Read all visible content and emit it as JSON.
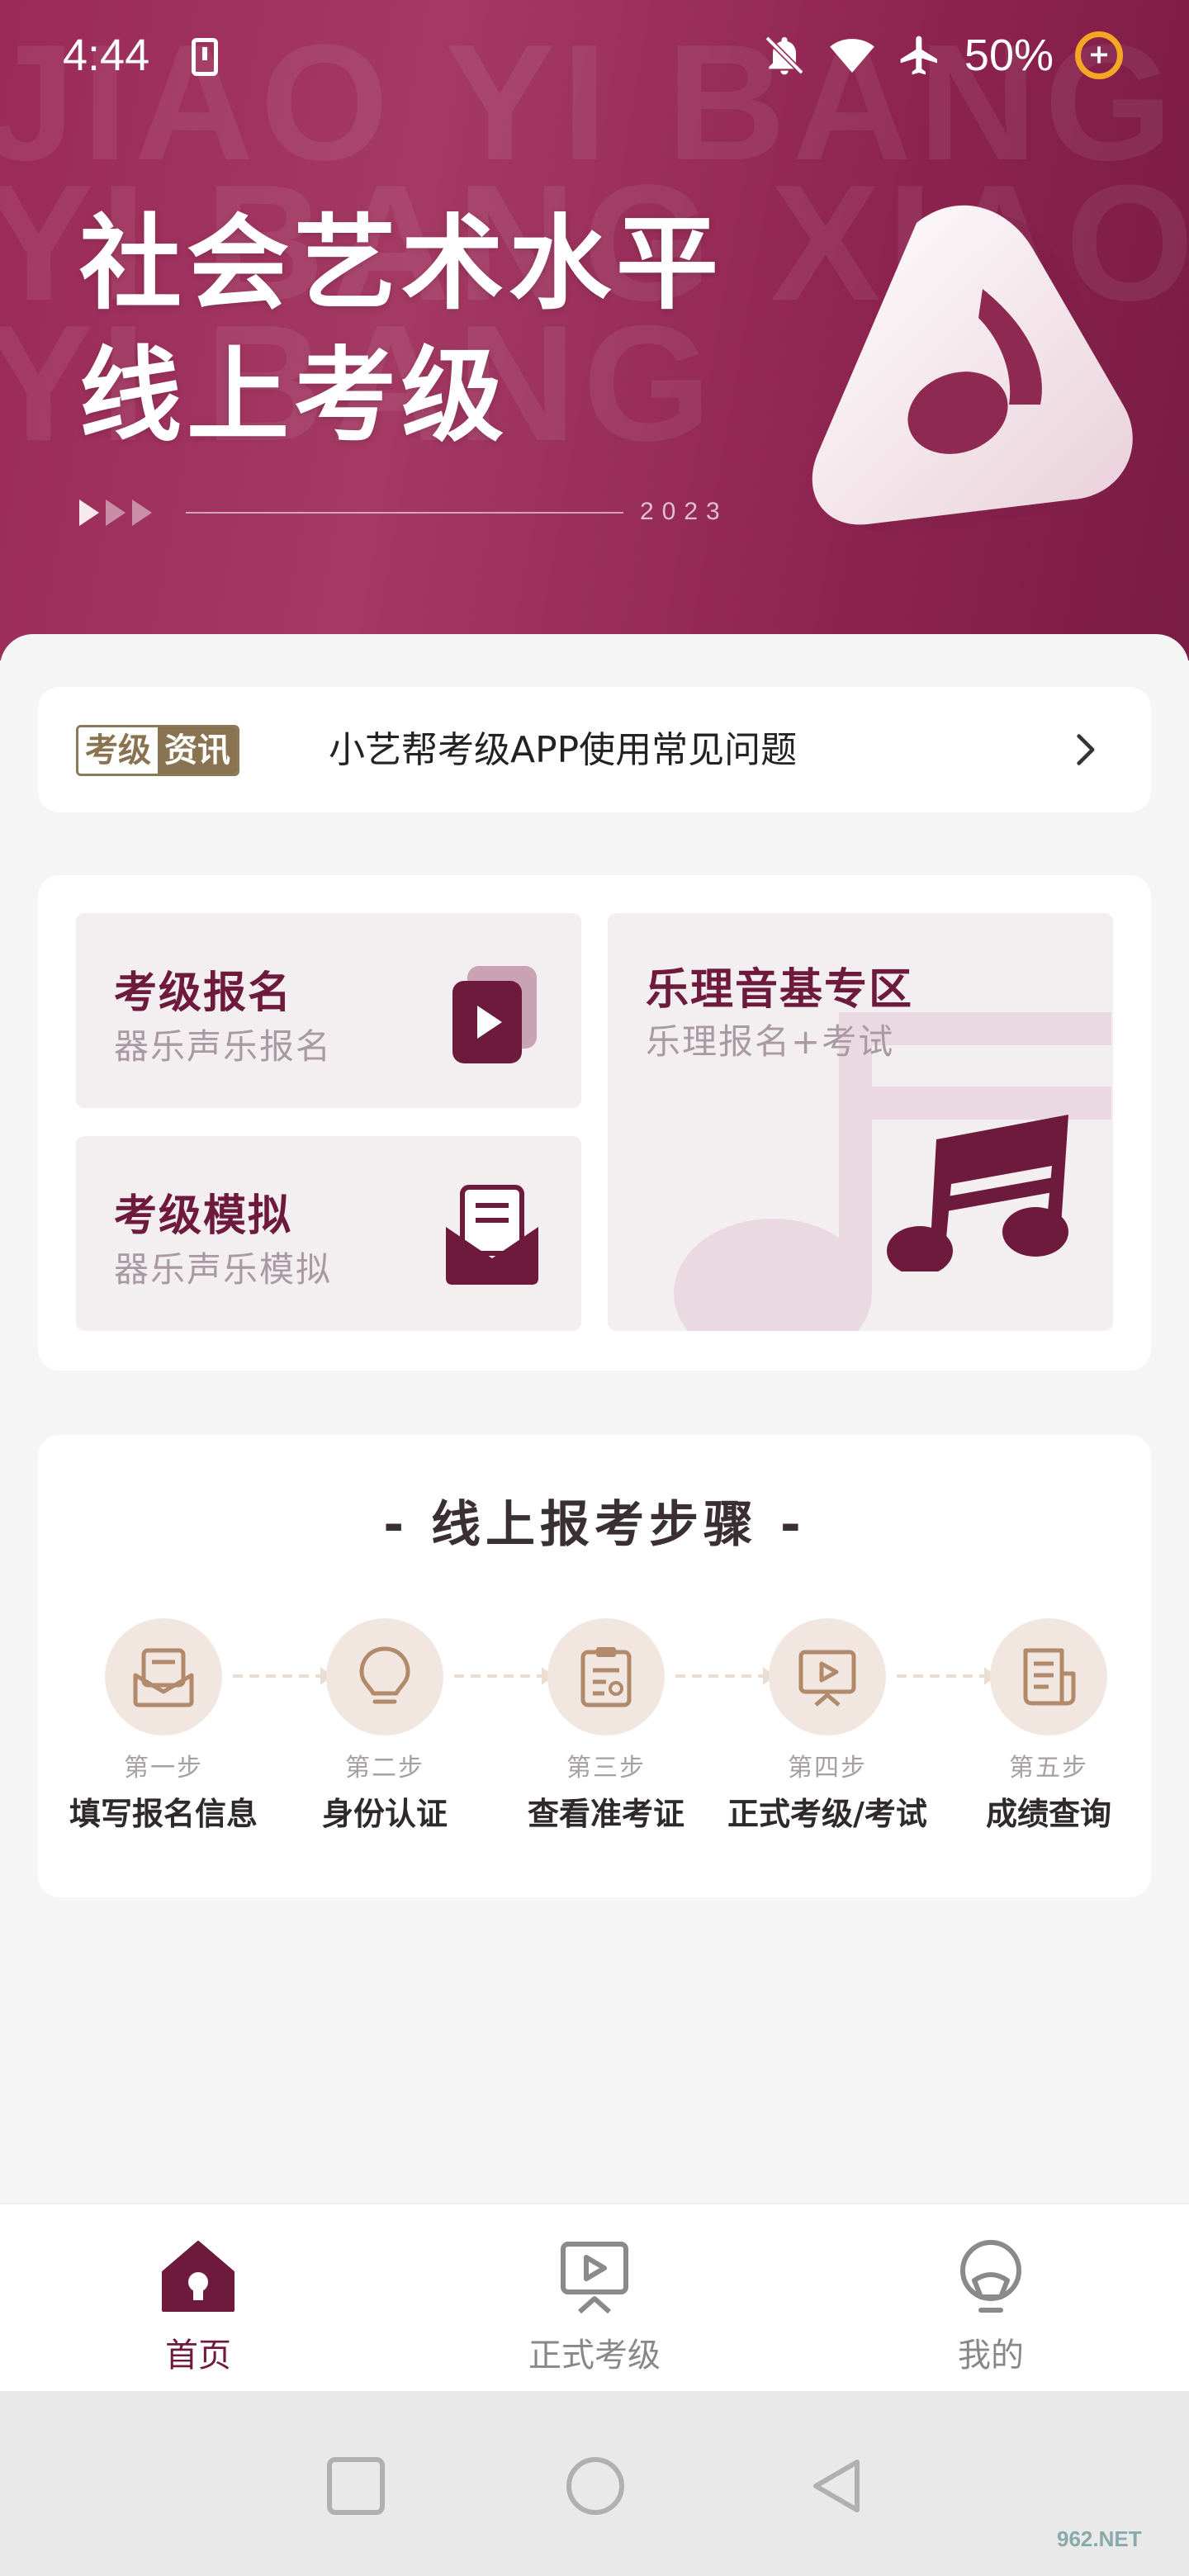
{
  "status_bar": {
    "time": "4:44",
    "battery": "50%"
  },
  "hero": {
    "watermark_lines": [
      "JIAO YI BANG",
      "YI BANG XIAO YI",
      "YI BANG"
    ],
    "title_line1": "社会艺术水平",
    "title_line2": "线上考级",
    "year": "2023"
  },
  "news": {
    "badge_left": "考级",
    "badge_right": "资讯",
    "text": "小艺帮考级APP使用常见问题"
  },
  "features": {
    "signup": {
      "title": "考级报名",
      "subtitle": "器乐声乐报名"
    },
    "mock": {
      "title": "考级模拟",
      "subtitle": "器乐声乐模拟"
    },
    "theory": {
      "title": "乐理音基专区",
      "subtitle": "乐理报名+考试"
    }
  },
  "steps": {
    "title": "- 线上报考步骤 -",
    "items": [
      {
        "num": "第一步",
        "label": "填写报名信息",
        "icon": "mail-icon"
      },
      {
        "num": "第二步",
        "label": "身份认证",
        "icon": "lightbulb-icon"
      },
      {
        "num": "第三步",
        "label": "查看准考证",
        "icon": "clipboard-icon"
      },
      {
        "num": "第四步",
        "label": "正式考级/考试",
        "icon": "video-play-icon"
      },
      {
        "num": "第五步",
        "label": "成绩查询",
        "icon": "document-icon"
      }
    ]
  },
  "tabbar": {
    "items": [
      {
        "label": "首页",
        "icon": "home-icon",
        "active": true
      },
      {
        "label": "正式考级",
        "icon": "play-screen-icon",
        "active": false
      },
      {
        "label": "我的",
        "icon": "user-icon",
        "active": false
      }
    ]
  },
  "colors": {
    "brand": "#6e1a3c",
    "hero_bg": "#9a2a57",
    "step_circle": "#f1e7e0",
    "step_icon": "#b08a6a",
    "badge_gold": "#8a7350"
  },
  "watermark_logo": "962.NET"
}
